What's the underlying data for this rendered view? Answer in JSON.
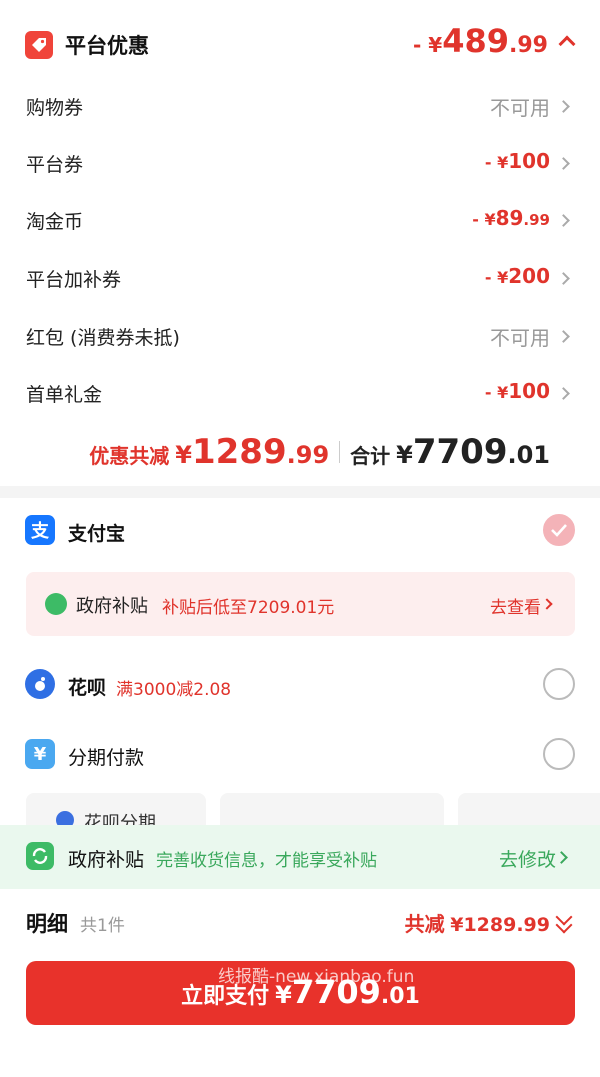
{
  "header": {
    "title": "平台优惠",
    "amount_prefix": "- ¥",
    "amount_int": "489",
    "amount_dec": ".99",
    "icon": "tag-icon"
  },
  "discounts": [
    {
      "label": "购物券",
      "value": "不可用",
      "available": false
    },
    {
      "label": "平台券",
      "value_prefix": "- ¥",
      "value_int": "100",
      "value_dec": "",
      "available": true
    },
    {
      "label": "淘金币",
      "value_prefix": "- ¥",
      "value_int": "89",
      "value_dec": ".99",
      "available": true
    },
    {
      "label": "平台加补券",
      "value_prefix": "- ¥",
      "value_int": "200",
      "value_dec": "",
      "available": true
    },
    {
      "label": "红包 (消费券未抵)",
      "value": "不可用",
      "available": false
    },
    {
      "label": "首单礼金",
      "value_prefix": "- ¥",
      "value_int": "100",
      "value_dec": "",
      "available": true
    }
  ],
  "totals": {
    "discount_label": "优惠共减",
    "discount_yen": "¥",
    "discount_int": "1289",
    "discount_dec": ".99",
    "sum_label": "合计",
    "sum_yen": "¥",
    "sum_int": "7709",
    "sum_dec": ".01"
  },
  "payment": {
    "alipay_label": "支付宝",
    "alipay_icon_glyph": "支",
    "subsidy_title": "政府补贴",
    "subsidy_desc": "补贴后低至7209.01元",
    "subsidy_link": "去查看",
    "huabei_label": "花呗",
    "huabei_promo": "满3000减2.08",
    "installment_label": "分期付款",
    "installment_icon_glyph": "¥",
    "card_label": "花呗分期"
  },
  "gov_bar": {
    "title": "政府补贴",
    "desc": "完善收货信息，才能享受补贴",
    "link": "去修改"
  },
  "detail": {
    "title": "明细",
    "count": "共1件",
    "total_label": "共减",
    "total_amount": "¥1289.99"
  },
  "pay_button": {
    "label": "立即支付",
    "yen": "¥",
    "amount_int": "7709",
    "amount_dec": ".01"
  },
  "watermark": "线报酷-new.xianbao.fun",
  "colors": {
    "accent_red": "#e0342c",
    "button_red": "#e8322b",
    "green": "#3dbb66",
    "alipay_blue": "#1677ff"
  }
}
